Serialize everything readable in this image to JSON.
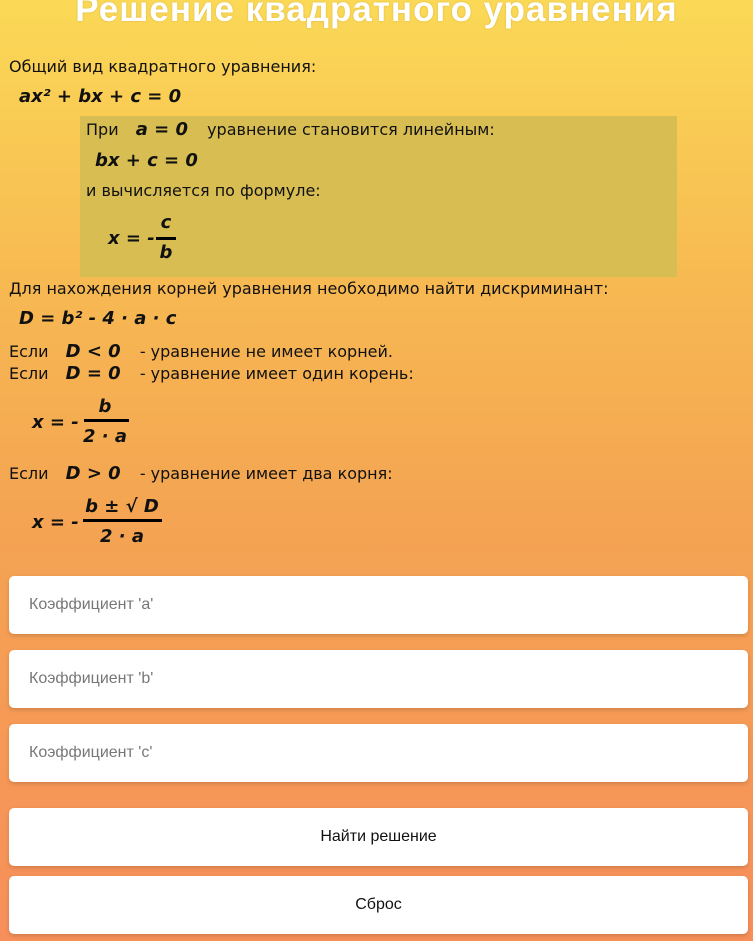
{
  "page": {
    "title": "Решение квадратного уравнения"
  },
  "theory": {
    "general_label": "Общий вид квадратного уравнения:",
    "general_formula": "ax² + bx + c = 0",
    "linear": {
      "when_prefix": "При",
      "when_condition": "a = 0",
      "when_suffix": "уравнение становится линейным:",
      "formula": "bx + c = 0",
      "computed_by": "и вычисляется по формуле:",
      "solution": {
        "prefix": "x = -",
        "numerator": "c",
        "denominator": "b"
      }
    },
    "discriminant_label": "Для нахождения корней уравнения необходимо найти дискриминант:",
    "discriminant_formula": "D = b² - 4 · a · c",
    "cases": [
      {
        "if": "Если",
        "condition": "D < 0",
        "text": "- уравнение не имеет корней."
      },
      {
        "if": "Если",
        "condition": "D = 0",
        "text": "- уравнение имеет один корень:"
      },
      {
        "if": "Если",
        "condition": "D > 0",
        "text": "- уравнение имеет два корня:"
      }
    ],
    "one_root": {
      "prefix": "x = -",
      "numerator": "b",
      "denominator": "2 · a"
    },
    "two_roots": {
      "prefix": "x = -",
      "numerator": "b ± √ D",
      "denominator": "2 · a"
    }
  },
  "form": {
    "a_placeholder": "Коэффициент 'a'",
    "b_placeholder": "Коэффициент 'b'",
    "c_placeholder": "Коэффициент 'c'",
    "solve_label": "Найти решение",
    "reset_label": "Сброс"
  },
  "colors": {
    "gradient_top": "#fbd956",
    "gradient_bottom": "#f78f5a",
    "linear_box": "#d8be52"
  }
}
